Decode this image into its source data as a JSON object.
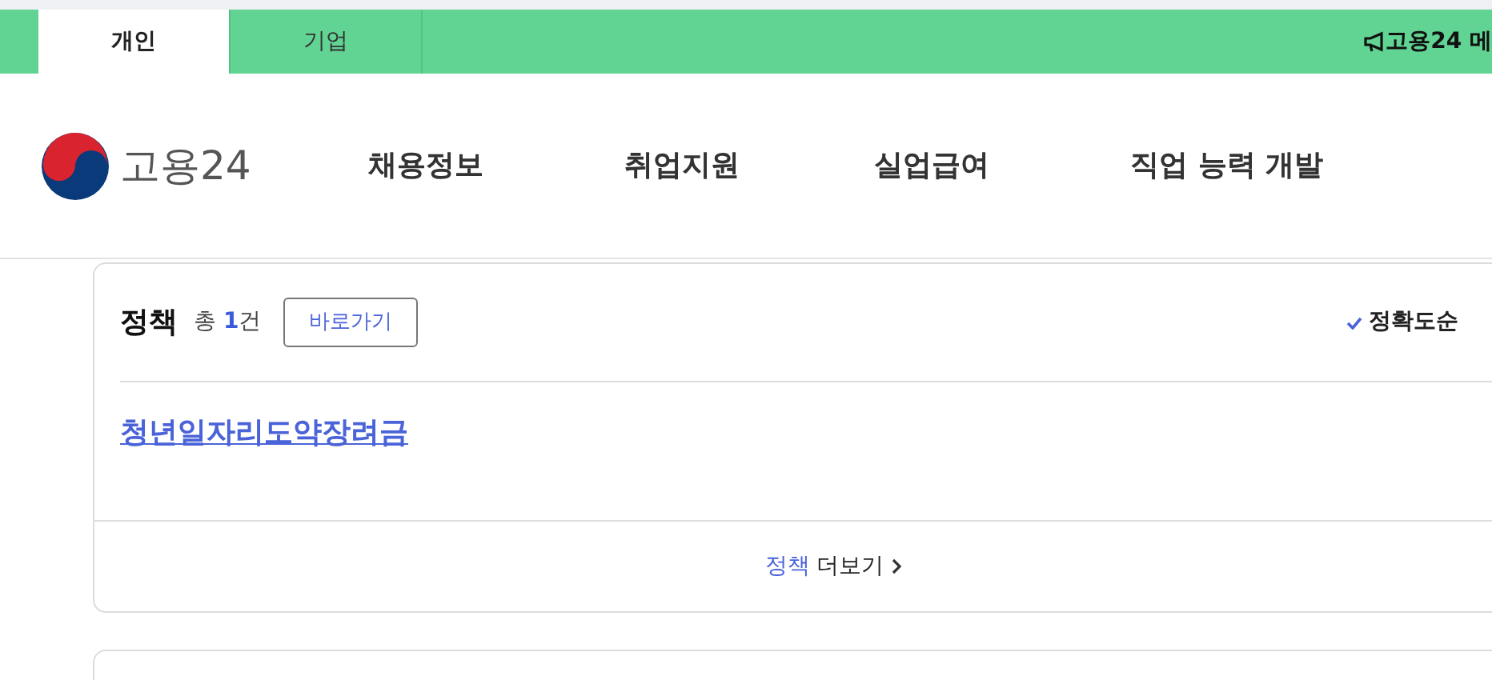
{
  "top_tabs": [
    {
      "label": "개인",
      "selected": true
    },
    {
      "label": "기업",
      "selected": false
    }
  ],
  "announcement": "고용24 메",
  "logo_text": "고용24",
  "nav": [
    "채용정보",
    "취업지원",
    "실업급여",
    "직업 능력 개발"
  ],
  "section": {
    "title": "정책",
    "total": "총 **1**건",
    "shortcut_button": "바로가기",
    "sort_options": [
      {
        "label": "정확도순",
        "selected": true
      }
    ],
    "results": [
      "청년일자리도약장려금"
    ],
    "more_link": {
      "category": "정책",
      "label": "더보기"
    }
  }
}
